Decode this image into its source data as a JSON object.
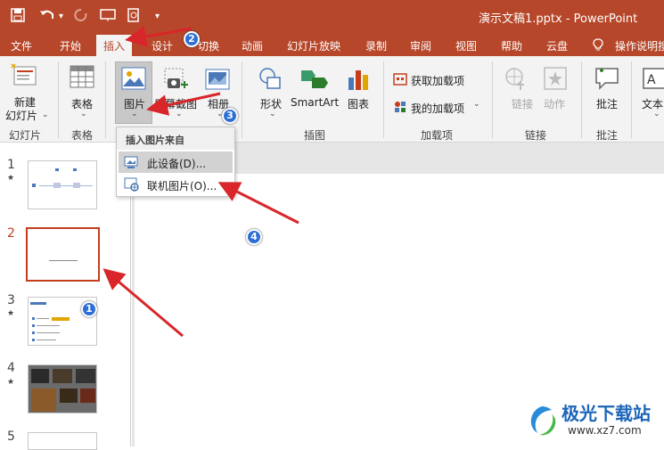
{
  "window": {
    "title": "演示文稿1.pptx  -  PowerPoint"
  },
  "quick_access": {
    "save_icon": "save-icon",
    "undo_icon": "undo-icon",
    "redo_icon": "redo-icon",
    "more": "▾"
  },
  "tabs": [
    {
      "label": "文件"
    },
    {
      "label": "开始"
    },
    {
      "label": "插入"
    },
    {
      "label": "设计"
    },
    {
      "label": "切换"
    },
    {
      "label": "动画"
    },
    {
      "label": "幻灯片放映"
    },
    {
      "label": "录制"
    },
    {
      "label": "审阅"
    },
    {
      "label": "视图"
    },
    {
      "label": "帮助"
    },
    {
      "label": "云盘"
    },
    {
      "label": "操作说明搜"
    }
  ],
  "ribbon": {
    "new_slide": "新建\n幻灯片",
    "new_slide_l1": "新建",
    "new_slide_l2": "幻灯片",
    "table": "表格",
    "picture": "图片",
    "screenshot": "屏幕截图",
    "album": "相册",
    "shapes": "形状",
    "smartart": "SmartArt",
    "chart": "图表",
    "get_addins": "获取加载项",
    "my_addins": "我的加载项",
    "link": "链接",
    "action": "动作",
    "comment": "批注",
    "textbox": "文本",
    "groups": {
      "slides": "幻灯片",
      "tables": "表格",
      "images": "插图",
      "addins": "加载项",
      "links": "链接",
      "comments": "批注"
    }
  },
  "dropdown": {
    "header": "插入图片来自",
    "items": [
      {
        "label": "此设备(D)...",
        "highlighted": true
      },
      {
        "label": "联机图片(O)...",
        "highlighted": false
      }
    ]
  },
  "slides": [
    {
      "num": "1",
      "star": "★"
    },
    {
      "num": "2",
      "star": ""
    },
    {
      "num": "3",
      "star": "★"
    },
    {
      "num": "4",
      "star": "★"
    },
    {
      "num": "5",
      "star": ""
    }
  ],
  "annotations": [
    "1",
    "2",
    "3",
    "4"
  ],
  "watermark": {
    "brand": "极光下载站",
    "url": "www.xz7.com"
  },
  "colors": {
    "accent": "#b7472a",
    "selected": "#c43e1c",
    "badge": "#2e6fd4",
    "arrow": "#d9262a"
  }
}
